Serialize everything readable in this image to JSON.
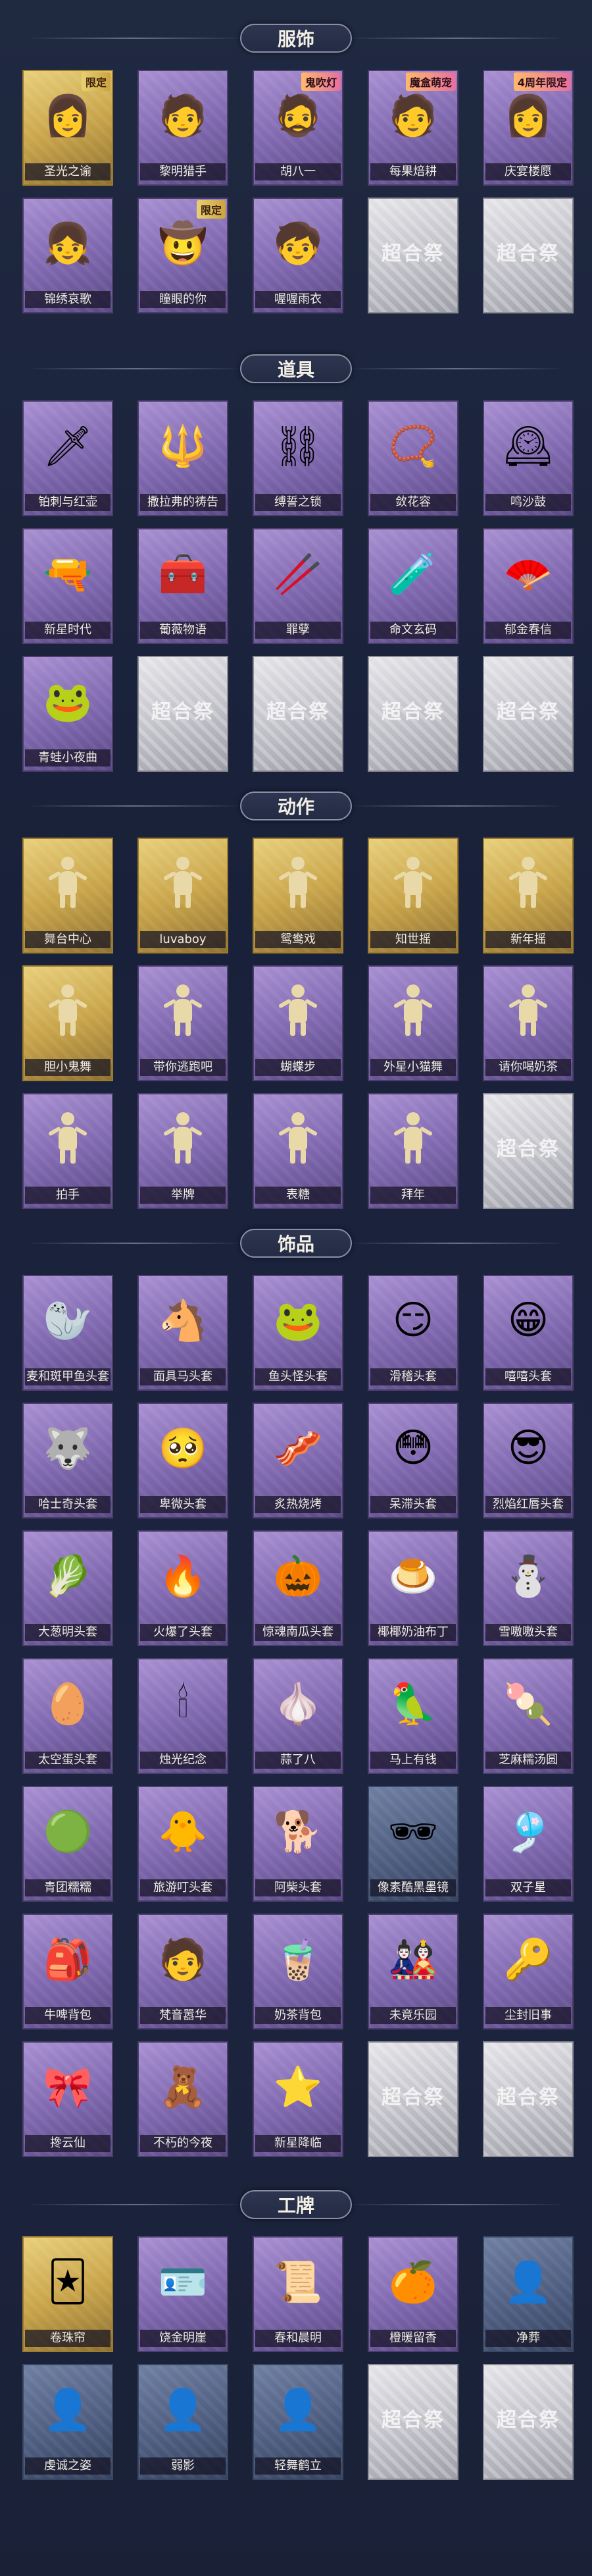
{
  "sections": [
    {
      "title": "服饰",
      "items": [
        {
          "name": "圣光之谕",
          "tier": "gold",
          "badge": "限定",
          "icon": "portrait-icon",
          "glyph": "👩"
        },
        {
          "name": "黎明猎手",
          "tier": "purple",
          "badge": "",
          "icon": "portrait-icon",
          "glyph": "🧑"
        },
        {
          "name": "胡八一",
          "tier": "purple",
          "badge": "鬼吹灯",
          "icon": "portrait-icon",
          "glyph": "🧔"
        },
        {
          "name": "每果焙耕",
          "tier": "purple",
          "badge": "魔盒萌宠",
          "icon": "portrait-icon",
          "glyph": "🧑"
        },
        {
          "name": "庆宴楼愿",
          "tier": "purple",
          "badge": "4周年限定",
          "icon": "portrait-icon",
          "glyph": "👩"
        },
        {
          "name": "锦绣哀歌",
          "tier": "purple",
          "badge": "",
          "icon": "portrait-icon",
          "glyph": "👧"
        },
        {
          "name": "瞳眼的你",
          "tier": "purple",
          "badge": "限定",
          "icon": "portrait-icon",
          "glyph": "🤠"
        },
        {
          "name": "喔喔雨衣",
          "tier": "purple",
          "badge": "",
          "icon": "portrait-icon",
          "glyph": "🧒"
        },
        {
          "name": "",
          "tier": "empty",
          "badge": "",
          "icon": "watermark-icon",
          "glyph": ""
        },
        {
          "name": "",
          "tier": "empty",
          "badge": "",
          "icon": "watermark-icon",
          "glyph": ""
        }
      ]
    },
    {
      "title": "道具",
      "items": [
        {
          "name": "铂刺与红壶",
          "tier": "purple",
          "badge": "",
          "icon": "sword-icon",
          "glyph": "🗡"
        },
        {
          "name": "撒拉弗的祷告",
          "tier": "purple",
          "badge": "",
          "icon": "staff-icon",
          "glyph": "🔱"
        },
        {
          "name": "缚誓之锁",
          "tier": "purple",
          "badge": "",
          "icon": "chain-icon",
          "glyph": "⛓"
        },
        {
          "name": "敛花容",
          "tier": "purple",
          "badge": "",
          "icon": "necklace-icon",
          "glyph": "📿"
        },
        {
          "name": "鸣沙鼓",
          "tier": "purple",
          "badge": "",
          "icon": "clock-icon",
          "glyph": "🕰"
        },
        {
          "name": "新星时代",
          "tier": "purple",
          "badge": "",
          "icon": "revolver-icon",
          "glyph": "🔫"
        },
        {
          "name": "葡薇物语",
          "tier": "purple",
          "badge": "",
          "icon": "medkit-icon",
          "glyph": "🧰"
        },
        {
          "name": "罪孽",
          "tier": "purple",
          "badge": "",
          "icon": "wand-icon",
          "glyph": "🥢"
        },
        {
          "name": "命文玄码",
          "tier": "purple",
          "badge": "",
          "icon": "bottle-icon",
          "glyph": "🧪"
        },
        {
          "name": "郁金春信",
          "tier": "purple",
          "badge": "",
          "icon": "fan-icon",
          "glyph": "🪭"
        },
        {
          "name": "青蛙小夜曲",
          "tier": "purple",
          "badge": "",
          "icon": "frog-icon",
          "glyph": "🐸"
        },
        {
          "name": "",
          "tier": "empty",
          "badge": "",
          "icon": "watermark-icon",
          "glyph": ""
        },
        {
          "name": "",
          "tier": "empty",
          "badge": "",
          "icon": "watermark-icon",
          "glyph": ""
        },
        {
          "name": "",
          "tier": "empty",
          "badge": "",
          "icon": "watermark-icon",
          "glyph": ""
        },
        {
          "name": "",
          "tier": "empty",
          "badge": "",
          "icon": "watermark-icon",
          "glyph": ""
        }
      ]
    },
    {
      "title": "动作",
      "items": [
        {
          "name": "舞台中心",
          "tier": "gold",
          "badge": "",
          "icon": "pose-icon",
          "glyph": ""
        },
        {
          "name": "luvaboy",
          "tier": "gold",
          "badge": "",
          "icon": "pose-icon",
          "glyph": ""
        },
        {
          "name": "鸳鸯戏",
          "tier": "gold",
          "badge": "",
          "icon": "pose-icon",
          "glyph": ""
        },
        {
          "name": "知世摇",
          "tier": "gold",
          "badge": "",
          "icon": "pose-icon",
          "glyph": ""
        },
        {
          "name": "新年摇",
          "tier": "gold",
          "badge": "",
          "icon": "pose-icon",
          "glyph": ""
        },
        {
          "name": "胆小鬼舞",
          "tier": "gold",
          "badge": "",
          "icon": "pose-icon",
          "glyph": ""
        },
        {
          "name": "带你逃跑吧",
          "tier": "purple",
          "badge": "",
          "icon": "pose-icon",
          "glyph": ""
        },
        {
          "name": "蝴蝶步",
          "tier": "purple",
          "badge": "",
          "icon": "pose-icon",
          "glyph": ""
        },
        {
          "name": "外星小猫舞",
          "tier": "purple",
          "badge": "",
          "icon": "pose-icon",
          "glyph": ""
        },
        {
          "name": "请你喝奶茶",
          "tier": "purple",
          "badge": "",
          "icon": "pose-icon",
          "glyph": ""
        },
        {
          "name": "拍手",
          "tier": "purple",
          "badge": "",
          "icon": "pose-icon",
          "glyph": ""
        },
        {
          "name": "举牌",
          "tier": "purple",
          "badge": "",
          "icon": "pose-icon",
          "glyph": ""
        },
        {
          "name": "表糖",
          "tier": "purple",
          "badge": "",
          "icon": "pose-icon",
          "glyph": ""
        },
        {
          "name": "拜年",
          "tier": "purple",
          "badge": "",
          "icon": "pose-icon",
          "glyph": ""
        },
        {
          "name": "",
          "tier": "empty",
          "badge": "",
          "icon": "watermark-icon",
          "glyph": ""
        }
      ]
    },
    {
      "title": "饰品",
      "items": [
        {
          "name": "麦和斑甲鱼头套",
          "tier": "purple",
          "badge": "",
          "icon": "seal-head-icon",
          "glyph": "🦭"
        },
        {
          "name": "面具马头套",
          "tier": "purple",
          "badge": "",
          "icon": "horse-head-icon",
          "glyph": "🐴"
        },
        {
          "name": "鱼头怪头套",
          "tier": "purple",
          "badge": "",
          "icon": "fish-head-icon",
          "glyph": "🐸"
        },
        {
          "name": "滑稽头套",
          "tier": "purple",
          "badge": "",
          "icon": "smirk-head-icon",
          "glyph": "😏"
        },
        {
          "name": "嘻嘻头套",
          "tier": "purple",
          "badge": "",
          "icon": "grin-head-icon",
          "glyph": "😁"
        },
        {
          "name": "哈士奇头套",
          "tier": "purple",
          "badge": "",
          "icon": "dog-head-icon",
          "glyph": "🐺"
        },
        {
          "name": "卑微头套",
          "tier": "purple",
          "badge": "",
          "icon": "sad-head-icon",
          "glyph": "🥺"
        },
        {
          "name": "炙热烧烤",
          "tier": "purple",
          "badge": "",
          "icon": "bbq-icon",
          "glyph": "🥓"
        },
        {
          "name": "呆滞头套",
          "tier": "purple",
          "badge": "",
          "icon": "dazed-head-icon",
          "glyph": "😳"
        },
        {
          "name": "烈焰红唇头套",
          "tier": "purple",
          "badge": "",
          "icon": "cool-head-icon",
          "glyph": "😎"
        },
        {
          "name": "大葱明头套",
          "tier": "purple",
          "badge": "",
          "icon": "leek-head-icon",
          "glyph": "🥬"
        },
        {
          "name": "火爆了头套",
          "tier": "purple",
          "badge": "",
          "icon": "fire-head-icon",
          "glyph": "🔥"
        },
        {
          "name": "惊魂南瓜头套",
          "tier": "purple",
          "badge": "",
          "icon": "pumpkin-head-icon",
          "glyph": "🎃"
        },
        {
          "name": "椰椰奶油布丁",
          "tier": "purple",
          "badge": "",
          "icon": "pudding-icon",
          "glyph": "🍮"
        },
        {
          "name": "雪嗷嗷头套",
          "tier": "purple",
          "badge": "",
          "icon": "snow-head-icon",
          "glyph": "⛄"
        },
        {
          "name": "太空蛋头套",
          "tier": "purple",
          "badge": "",
          "icon": "egg-head-icon",
          "glyph": "🥚"
        },
        {
          "name": "烛光纪念",
          "tier": "purple",
          "badge": "",
          "icon": "candle-icon",
          "glyph": "🕯"
        },
        {
          "name": "蒜了八",
          "tier": "purple",
          "badge": "",
          "icon": "garlic-icon",
          "glyph": "🧄"
        },
        {
          "name": "马上有钱",
          "tier": "purple",
          "badge": "",
          "icon": "bird-icon",
          "glyph": "🦜"
        },
        {
          "name": "芝麻糯汤圆",
          "tier": "purple",
          "badge": "",
          "icon": "dumpling-icon",
          "glyph": "🍡"
        },
        {
          "name": "青团糯糯",
          "tier": "purple",
          "badge": "",
          "icon": "green-bun-icon",
          "glyph": "🟢"
        },
        {
          "name": "旅游叮头套",
          "tier": "purple",
          "badge": "",
          "icon": "duck-head-icon",
          "glyph": "🐥"
        },
        {
          "name": "阿柴头套",
          "tier": "purple",
          "badge": "",
          "icon": "shiba-head-icon",
          "glyph": "🐕"
        },
        {
          "name": "像素酷黑墨镜",
          "tier": "blue",
          "badge": "",
          "icon": "sunglasses-icon",
          "glyph": "🕶"
        },
        {
          "name": "双子星",
          "tier": "purple",
          "badge": "",
          "icon": "ornament-icon",
          "glyph": "🎐"
        },
        {
          "name": "牛啤背包",
          "tier": "purple",
          "badge": "",
          "icon": "backpack-icon",
          "glyph": "🎒"
        },
        {
          "name": "梵音嚣华",
          "tier": "purple",
          "badge": "",
          "icon": "monk-icon",
          "glyph": "🧑"
        },
        {
          "name": "奶茶背包",
          "tier": "purple",
          "badge": "",
          "icon": "qr-backpack-icon",
          "glyph": "🧋"
        },
        {
          "name": "未竟乐园",
          "tier": "purple",
          "badge": "",
          "icon": "doll-icon",
          "glyph": "🎎"
        },
        {
          "name": "尘封旧事",
          "tier": "purple",
          "badge": "",
          "icon": "keychain-icon",
          "glyph": "🔑"
        },
        {
          "name": "搀云仙",
          "tier": "purple",
          "badge": "",
          "icon": "charm-icon",
          "glyph": "🎀"
        },
        {
          "name": "不朽的今夜",
          "tier": "purple",
          "badge": "",
          "icon": "charm-icon",
          "glyph": "🧸"
        },
        {
          "name": "新星降临",
          "tier": "purple",
          "badge": "",
          "icon": "charm-icon",
          "glyph": "⭐"
        },
        {
          "name": "",
          "tier": "empty",
          "badge": "",
          "icon": "watermark-icon",
          "glyph": ""
        },
        {
          "name": "",
          "tier": "empty",
          "badge": "",
          "icon": "watermark-icon",
          "glyph": ""
        }
      ]
    },
    {
      "title": "工牌",
      "items": [
        {
          "name": "卷珠帘",
          "tier": "gold",
          "badge": "",
          "icon": "badge-card-icon",
          "glyph": "🃏"
        },
        {
          "name": "饶金明崖",
          "tier": "purple",
          "badge": "",
          "icon": "badge-card-icon",
          "glyph": "🪪"
        },
        {
          "name": "春和晨明",
          "tier": "purple",
          "badge": "",
          "icon": "badge-card-icon",
          "glyph": "📜"
        },
        {
          "name": "橙暖留香",
          "tier": "purple",
          "badge": "",
          "icon": "badge-card-icon",
          "glyph": "🍊"
        },
        {
          "name": "净葬",
          "tier": "blue",
          "badge": "",
          "icon": "badge-card-icon",
          "glyph": "👤"
        },
        {
          "name": "虔诚之姿",
          "tier": "blue",
          "badge": "",
          "icon": "badge-card-icon",
          "glyph": "👤"
        },
        {
          "name": "弱影",
          "tier": "blue",
          "badge": "",
          "icon": "badge-card-icon",
          "glyph": "👤"
        },
        {
          "name": "轻舞鹤立",
          "tier": "blue",
          "badge": "",
          "icon": "badge-card-icon",
          "glyph": "👤"
        },
        {
          "name": "",
          "tier": "empty",
          "badge": "",
          "icon": "watermark-icon",
          "glyph": ""
        },
        {
          "name": "",
          "tier": "empty",
          "badge": "",
          "icon": "watermark-icon",
          "glyph": ""
        }
      ]
    }
  ],
  "watermark_text": "超合祭"
}
